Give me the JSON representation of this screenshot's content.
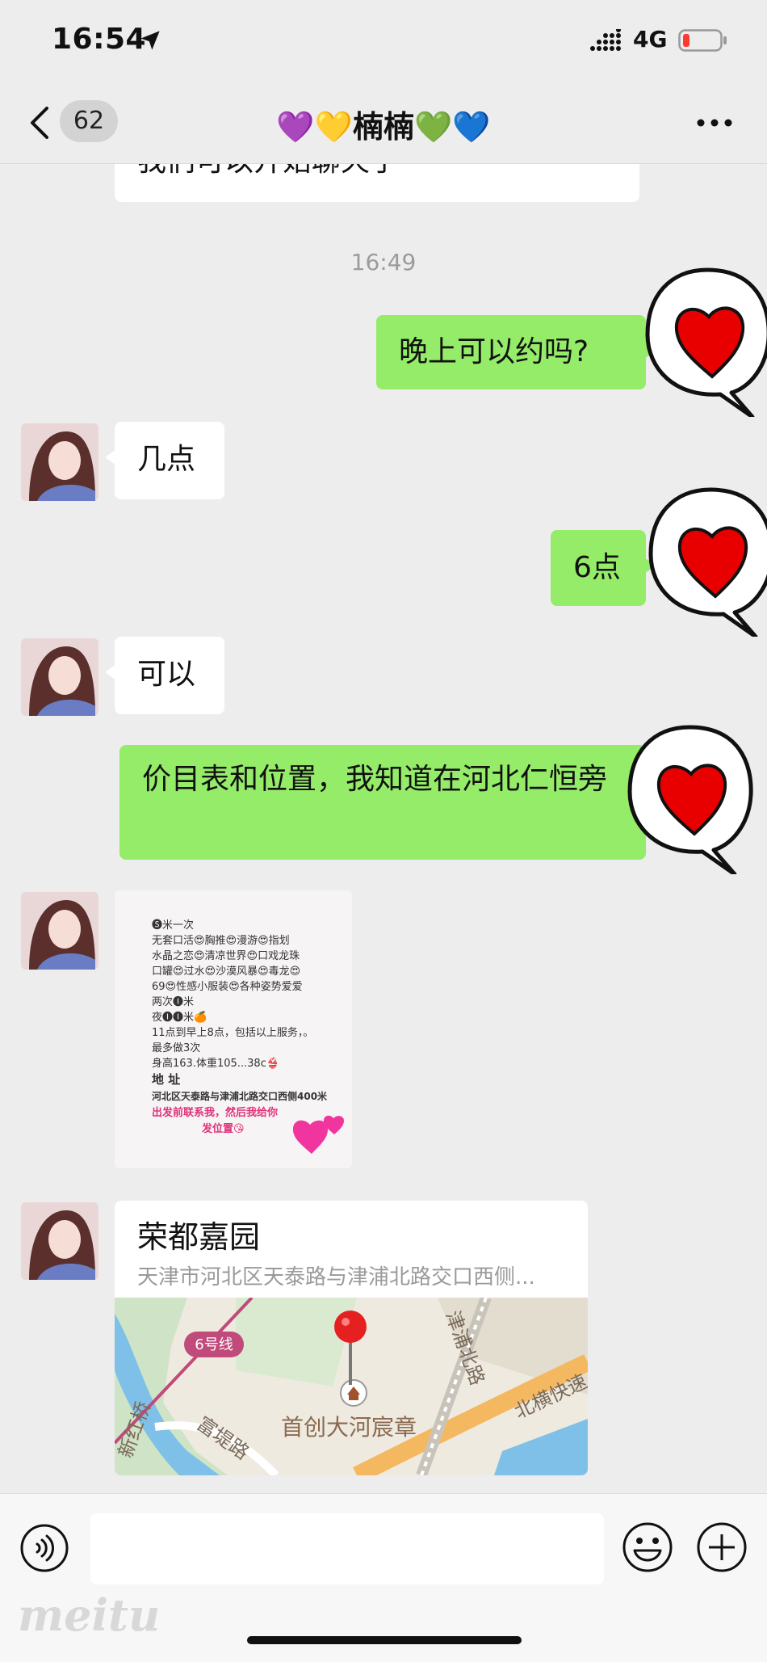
{
  "status": {
    "time": "16:54",
    "network": "4G",
    "battery_color": "#ff3b30"
  },
  "nav": {
    "unread_count": "62",
    "title": "💜💛楠楠💚💙"
  },
  "chat": {
    "cut_message": "我们可以开始聊天了",
    "timestamp": "16:49",
    "messages": [
      {
        "side": "me",
        "text": "晚上可以约吗?"
      },
      {
        "side": "other",
        "text": "几点"
      },
      {
        "side": "me",
        "text": "6点"
      },
      {
        "side": "other",
        "text": "可以"
      },
      {
        "side": "me",
        "text": "价目表和位置，我知道在河北仁恒旁"
      }
    ],
    "image_lines": [
      "🅢米一次",
      "无套口活😍胸推😍漫游😍指划",
      "水晶之恋😍清凉世界😍口戏龙珠",
      "口罐😍过水😍沙漠风暴😍毒龙😍",
      "69😍性感小服装😍各种姿势爱爱",
      "两次🅘米",
      "夜🅘🅘米🍊",
      " 11点到早上8点，包括以上服务，。",
      "最多做3次",
      "身高163.体重105...38c👙",
      "地 址",
      "河北区天泰路与津浦北路交口西侧400米",
      "出发前联系我，然后我给你",
      "发位置😘"
    ],
    "location": {
      "name": "荣都嘉园",
      "address": "天津市河北区天泰路与津浦北路交口西侧...",
      "map_labels": {
        "metro": "6号线",
        "road1": "新红桥",
        "road2": "富堤路",
        "road3": "津浦北路",
        "road4": "北横快速",
        "poi": "首创大河宸章"
      }
    }
  },
  "watermark": "meitu"
}
